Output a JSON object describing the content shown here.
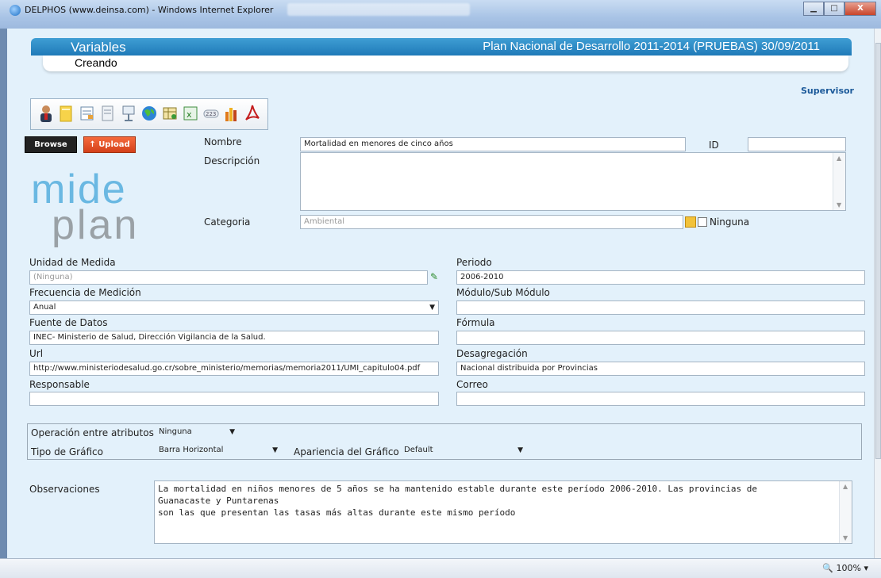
{
  "window": {
    "title": "DELPHOS (www.deinsa.com) - Windows Internet Explorer",
    "zoom": "100%"
  },
  "header": {
    "section": "Variables",
    "plan": "Plan Nacional de Desarrollo 2011-2014 (PRUEBAS) 30/09/2011",
    "mode": "Creando",
    "role": "Supervisor"
  },
  "toolbar": {
    "icons": [
      "user-icon",
      "folder-icon",
      "edit-form-icon",
      "document-icon",
      "presentation-icon",
      "globe-icon",
      "table-icon",
      "excel-icon",
      "link-icon",
      "bar-chart-icon",
      "pdf-icon"
    ]
  },
  "upload": {
    "browse_label": "Browse",
    "upload_label": "Upload"
  },
  "logo": {
    "line1": "mide",
    "line2": "plan"
  },
  "form": {
    "nombre_label": "Nombre",
    "nombre_value": "Mortalidad en menores de cinco años",
    "id_label": "ID",
    "id_value": "",
    "descripcion_label": "Descripción",
    "descripcion_value": "",
    "categoria_label": "Categoria",
    "categoria_value": "Ambiental",
    "ninguna_label": "Ninguna",
    "unidad_label": "Unidad de Medida",
    "unidad_value": "(Ninguna)",
    "frecuencia_label": "Frecuencia de Medición",
    "frecuencia_value": "Anual",
    "fuente_label": "Fuente de Datos",
    "fuente_value": "INEC- Ministerio de Salud, Dirección Vigilancia de la Salud.",
    "url_label": "Url",
    "url_value": "http://www.ministeriodesalud.go.cr/sobre_ministerio/memorias/memoria2011/UMI_capitulo04.pdf",
    "responsable_label": "Responsable",
    "responsable_value": "",
    "periodo_label": "Periodo",
    "periodo_value": "2006-2010",
    "modulo_label": "Módulo/Sub Módulo",
    "modulo_value": "",
    "formula_label": "Fórmula",
    "formula_value": "",
    "desagregacion_label": "Desagregación",
    "desagregacion_value": "Nacional distribuida por Provincias",
    "correo_label": "Correo",
    "correo_value": "",
    "operacion_label": "Operación entre atributos",
    "operacion_value": "Ninguna",
    "tipo_label": "Tipo de Gráfico",
    "tipo_value": "Barra Horizontal",
    "apariencia_label": "Apariencia del Gráfico",
    "apariencia_value": "Default",
    "observaciones_label": "Observaciones",
    "observaciones_value": "La mortalidad en niños menores de 5 años se ha mantenido estable durante este período 2006-2010. Las provincias de\nGuanacaste y Puntarenas\nson las que presentan las tasas más altas durante este mismo período"
  }
}
